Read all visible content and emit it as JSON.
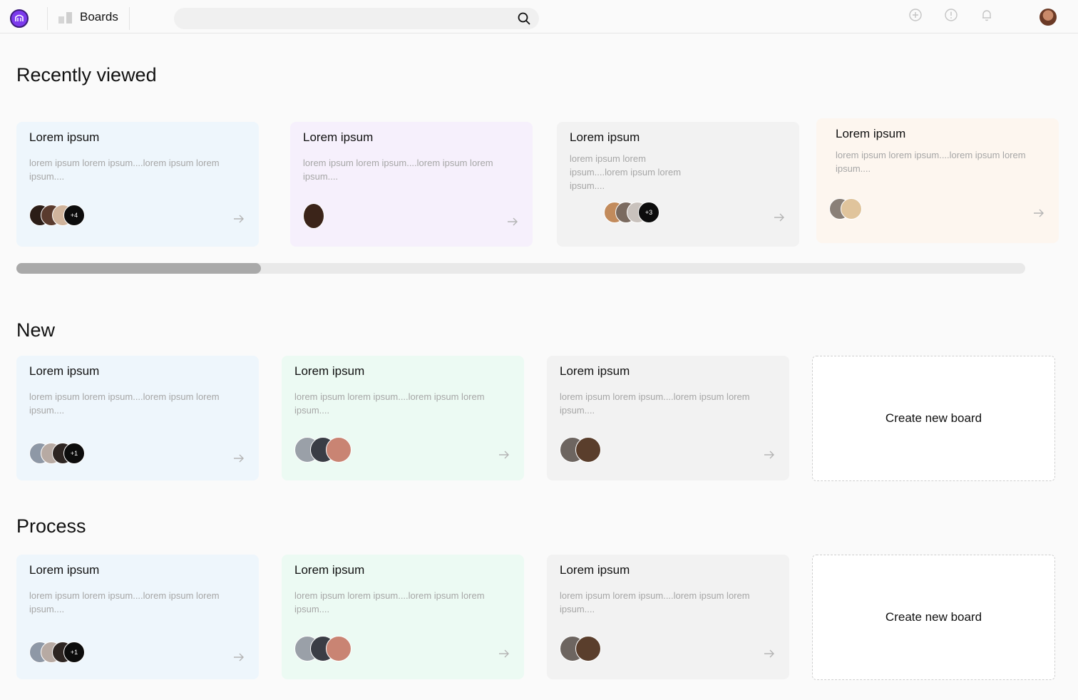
{
  "header": {
    "breadcrumb_label": "Boards",
    "search_placeholder": "",
    "icons": [
      "plus-circle-icon",
      "info-icon",
      "bell-icon"
    ]
  },
  "sections": {
    "recent": {
      "title": "Recently viewed"
    },
    "new": {
      "title": "New"
    },
    "process": {
      "title": "Process"
    }
  },
  "recent_cards": [
    {
      "title": "Lorem ipsum",
      "desc": "lorem ipsum lorem ipsum....lorem ipsum lorem ipsum....",
      "more": "+4"
    },
    {
      "title": "Lorem ipsum",
      "desc": "lorem ipsum lorem ipsum....lorem ipsum lorem ipsum....",
      "more": ""
    },
    {
      "title": "Lorem ipsum",
      "desc": "lorem ipsum lorem ipsum....lorem ipsum lorem ipsum....",
      "more": "+3"
    },
    {
      "title": "Lorem ipsum",
      "desc": "lorem ipsum lorem ipsum....lorem ipsum lorem ipsum....",
      "more": ""
    }
  ],
  "new_cards": [
    {
      "title": "Lorem ipsum",
      "desc": "lorem ipsum lorem ipsum....lorem ipsum lorem ipsum....",
      "more": "+1"
    },
    {
      "title": "Lorem ipsum",
      "desc": "lorem ipsum lorem ipsum....lorem ipsum lorem ipsum....",
      "more": ""
    },
    {
      "title": "Lorem ipsum",
      "desc": "lorem ipsum lorem ipsum....lorem ipsum lorem ipsum....",
      "more": ""
    }
  ],
  "process_cards": [
    {
      "title": "Lorem ipsum",
      "desc": "lorem ipsum lorem ipsum....lorem ipsum lorem ipsum....",
      "more": "+1"
    },
    {
      "title": "Lorem ipsum",
      "desc": "lorem ipsum lorem ipsum....lorem ipsum lorem ipsum....",
      "more": ""
    },
    {
      "title": "Lorem ipsum",
      "desc": "lorem ipsum lorem ipsum....lorem ipsum lorem ipsum....",
      "more": ""
    }
  ],
  "create_label": "Create new board",
  "colors": {
    "blue": "#eef6fc",
    "purple": "#f6f0fc",
    "gray": "#f2f2f2",
    "peach": "#fdf6ef",
    "green": "#ecfaf3",
    "brand": "#7c3aed"
  }
}
